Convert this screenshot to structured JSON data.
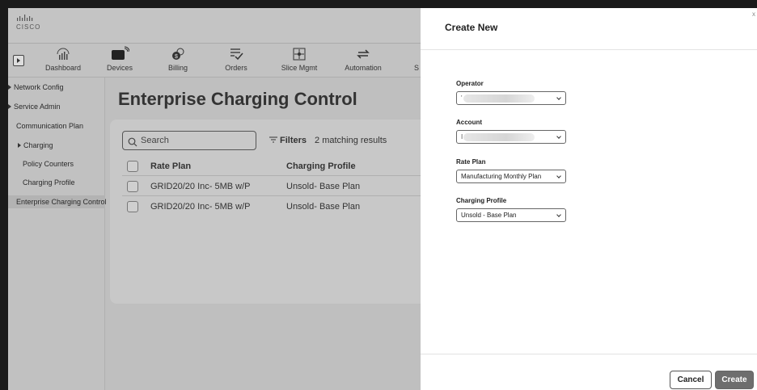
{
  "brand": {
    "logo_text": "CISCO"
  },
  "nav": {
    "items": [
      {
        "label": "Dashboard",
        "icon": "dashboard-icon"
      },
      {
        "label": "Devices",
        "icon": "devices-icon"
      },
      {
        "label": "Billing",
        "icon": "billing-icon"
      },
      {
        "label": "Orders",
        "icon": "orders-icon"
      },
      {
        "label": "Slice Mgmt",
        "icon": "slice-mgmt-icon"
      },
      {
        "label": "Automation",
        "icon": "automation-icon"
      },
      {
        "label": "S",
        "icon": ""
      }
    ]
  },
  "sidebar": {
    "items": [
      {
        "label": "Network Config",
        "expandable": true
      },
      {
        "label": "Service Admin",
        "expandable": true
      },
      {
        "label": "Communication Plan"
      },
      {
        "label": "Charging",
        "expandable": true
      },
      {
        "label": "Policy Counters"
      },
      {
        "label": "Charging Profile"
      },
      {
        "label": "Enterprise Charging Control",
        "active": true
      }
    ]
  },
  "main": {
    "title": "Enterprise Charging Control",
    "search_placeholder": "Search",
    "filters_label": "Filters",
    "matching_text": "2 matching results",
    "table": {
      "columns": [
        "Rate Plan",
        "Charging Profile"
      ],
      "rows": [
        [
          "GRID20/20 Inc- 5MB w/P",
          "Unsold- Base Plan"
        ],
        [
          "GRID20/20 Inc- 5MB w/P",
          "Unsold- Base Plan"
        ]
      ]
    }
  },
  "panel": {
    "title": "Create New",
    "close": "x",
    "fields": [
      {
        "label": "Operator",
        "value": "",
        "redacted": true,
        "mark": "'"
      },
      {
        "label": "Account",
        "value": "",
        "redacted": true,
        "mark": "I"
      },
      {
        "label": "Rate Plan",
        "value": "Manufacturing Monthly Plan"
      },
      {
        "label": "Charging Profile",
        "value": "Unsold - Base Plan"
      }
    ],
    "cancel_label": "Cancel",
    "create_label": "Create"
  },
  "colors": {
    "overlay_background": "#bfbfbf",
    "panel_background": "#ffffff",
    "primary_button": "#6e6e6e"
  }
}
